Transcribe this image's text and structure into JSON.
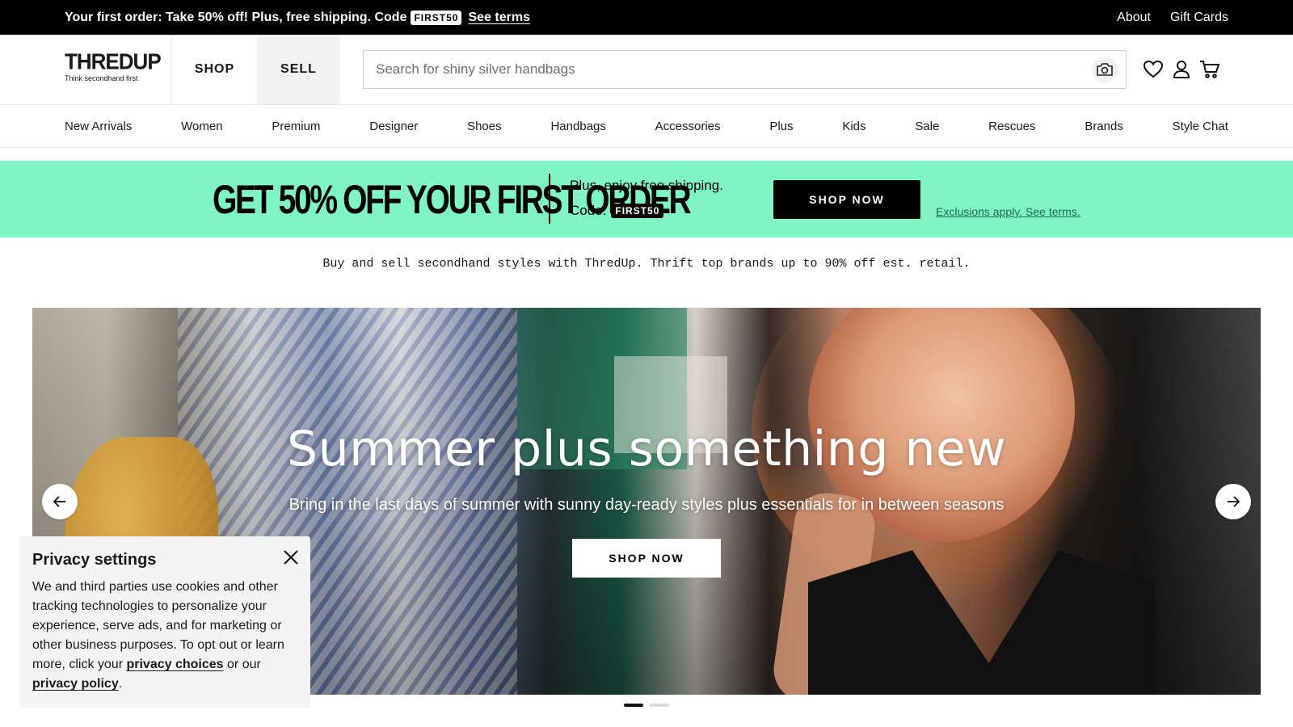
{
  "announcement": {
    "promo_text": "Your first order: Take 50% off! Plus, free shipping. Code",
    "code": "FIRST50",
    "terms_link": "See terms",
    "utility_links": [
      "About",
      "Gift Cards"
    ]
  },
  "header": {
    "logo_wordmark": "THREDUP",
    "logo_tagline": "Think secondhand first",
    "mode_tabs": [
      "SHOP",
      "SELL"
    ],
    "active_mode": "SHOP",
    "search_placeholder": "Search for shiny silver handbags",
    "icons": [
      "camera-icon",
      "heart-icon",
      "user-icon",
      "cart-icon"
    ]
  },
  "categories": [
    "New Arrivals",
    "Women",
    "Premium",
    "Designer",
    "Shoes",
    "Handbags",
    "Accessories",
    "Plus",
    "Kids",
    "Sale",
    "Rescues",
    "Brands",
    "Style Chat"
  ],
  "promo_band": {
    "headline": "GET 50% OFF YOUR FIRST ORDER",
    "shipping_text": "Plus, enjoy free shipping.",
    "code_label": "Code:",
    "code": "FIRST50",
    "cta": "SHOP NOW",
    "exclusions": "Exclusions apply. See terms.",
    "background": "#7ff5c4"
  },
  "tagline": "Buy and sell secondhand styles with ThredUp. Thrift top brands up to 90% off est. retail.",
  "hero": {
    "title": "Summer plus something new",
    "subtitle": "Bring in the last days of summer with sunny day-ready styles plus essentials for in between seasons",
    "cta": "SHOP NOW",
    "slide_count": 2,
    "active_slide": 1
  },
  "privacy": {
    "title": "Privacy settings",
    "text_before": "We and third parties use cookies and other tracking technologies to personalize your experience, serve ads, and for marketing or other business purposes. To opt out or learn more, click your",
    "link_choices": "privacy choices",
    "text_middle": "or our",
    "link_policy": "privacy policy",
    "text_end": "."
  },
  "colors": {
    "announcement_bg": "#000000",
    "promo_accent": "#7ff5c4",
    "cta_bg": "#000000"
  }
}
